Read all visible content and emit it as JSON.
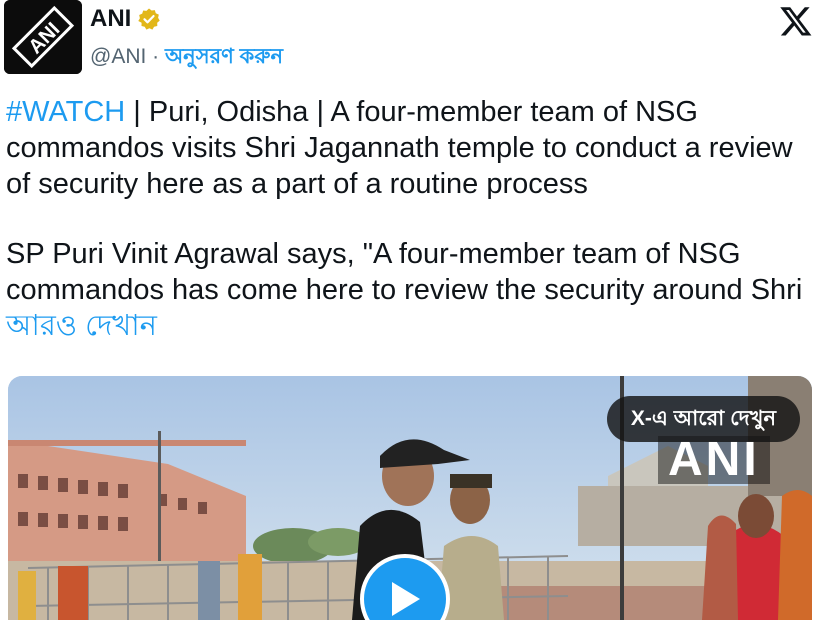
{
  "author": {
    "display_name": "ANI",
    "handle": "@ANI",
    "separator": " · ",
    "follow_label": "অনুসরণ করুন",
    "avatar_text": "ANI",
    "verified_color": "#e2b719"
  },
  "platform": {
    "logo_icon": "x-logo-icon"
  },
  "tweet": {
    "hashtag": "#WATCH",
    "para1_rest": " | Puri, Odisha  | A four-member team of NSG commandos visits Shri Jagannath temple to conduct a review of security here as a part of a routine process",
    "para2": "SP Puri Vinit Agrawal says, \"A four-member team of NSG commandos has come here to review the security around Shri ",
    "show_more": "আরও দেখান"
  },
  "media": {
    "view_on_x": "X-এ আরো দেখুন",
    "watermark": "ANI",
    "play_icon": "play-icon"
  },
  "colors": {
    "link": "#1d9bf0",
    "text": "#0f1419",
    "muted": "#536471"
  }
}
